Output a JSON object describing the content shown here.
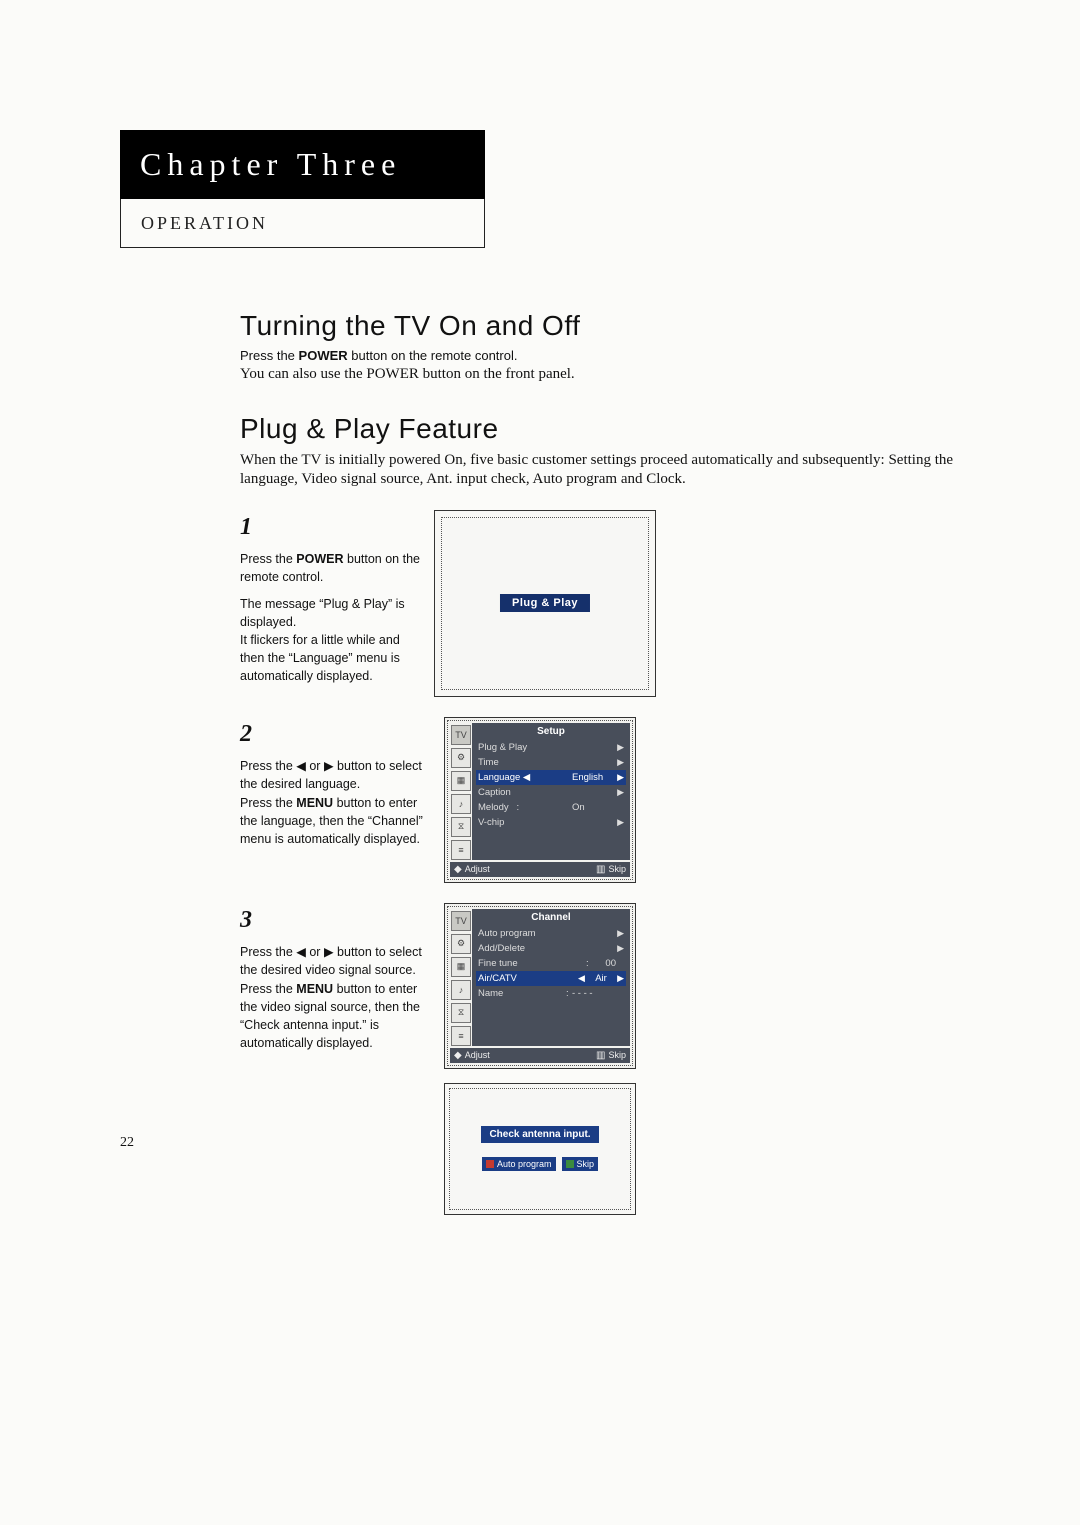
{
  "page_number": "22",
  "chapter": {
    "title": "Chapter Three",
    "subtitle": "OPERATION"
  },
  "section1": {
    "heading": "Turning the TV On and Off",
    "line1_pre": "Press the ",
    "line1_kw": "POWER",
    "line1_post": " button on the remote control.",
    "line2": "You can also use the POWER button on the front panel."
  },
  "section2": {
    "heading": "Plug & Play Feature",
    "intro": "When the TV is initially powered On, five basic customer settings proceed automatically and subsequently: Setting the language, Video signal source, Ant. input check, Auto program and Clock."
  },
  "step1": {
    "num": "1",
    "t1_pre": "Press the ",
    "t1_kw": "POWER",
    "t1_post": " button on the remote control.",
    "t2": "The message “Plug & Play” is displayed.",
    "t3": "It flickers for a little while and then the “Language” menu is automatically displayed.",
    "osd_badge": "Plug & Play"
  },
  "step2": {
    "num": "2",
    "t1": "Press the ◀ or ▶ button to select the desired language.",
    "t2_pre": "Press the ",
    "t2_kw": "MENU",
    "t2_post": " button to enter the language, then the “Channel” menu is automatically displayed.",
    "osd": {
      "title": "Setup",
      "items": {
        "pp": {
          "label": "Plug & Play"
        },
        "time": {
          "label": "Time"
        },
        "lang": {
          "label": "Language",
          "value": "English"
        },
        "cap": {
          "label": "Caption"
        },
        "mel": {
          "label": "Melody",
          "sep": ":",
          "value": "On"
        },
        "vchip": {
          "label": "V-chip"
        }
      },
      "footer_left": "Adjust",
      "footer_right": "Skip"
    }
  },
  "step3": {
    "num": "3",
    "t1": "Press the ◀ or ▶ button to select the desired video signal source.",
    "t2_pre": "Press the ",
    "t2_kw": "MENU",
    "t2_post": " button to enter the video signal source, then the “Check antenna input.” is automatically displayed.",
    "osd": {
      "title": "Channel",
      "items": {
        "auto": {
          "label": "Auto program"
        },
        "add": {
          "label": "Add/Delete"
        },
        "fine": {
          "label": "Fine tune",
          "sep": ":",
          "value": "00"
        },
        "air": {
          "label": "Air/CATV",
          "value": "Air"
        },
        "name": {
          "label": "Name",
          "sep": ":",
          "value": "- - - -"
        }
      },
      "footer_left": "Adjust",
      "footer_right": "Skip"
    },
    "check_osd": {
      "title": "Check antenna input.",
      "btn1": "Auto program",
      "btn2": "Skip"
    }
  },
  "icons": {
    "tv": "TV",
    "setup": "⚙",
    "picture": "▦",
    "sound": "♪",
    "clock": "⧖",
    "bars": "≡"
  }
}
